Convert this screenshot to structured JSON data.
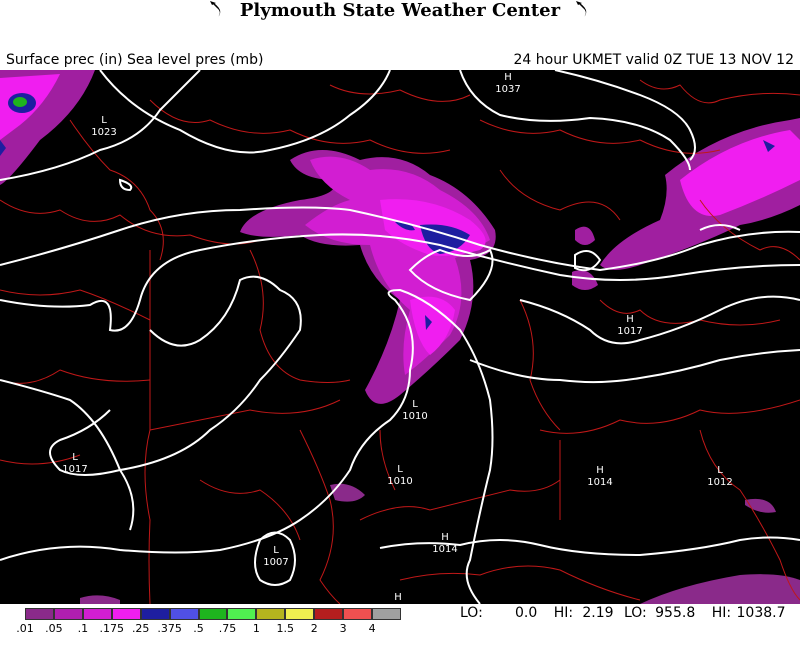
{
  "title": "Plymouth State Weather Center",
  "header": {
    "left": "Surface prec (in) Sea level pres (mb)",
    "right": "24 hour UKMET valid 0Z TUE 13 NOV 12"
  },
  "pressure_centers": [
    {
      "letter": "H",
      "value": "1037"
    },
    {
      "letter": "L",
      "value": "1023"
    },
    {
      "letter": "L",
      "value": "1017"
    },
    {
      "letter": "L",
      "value": "1010"
    },
    {
      "letter": "H",
      "value": "1017"
    },
    {
      "letter": "L",
      "value": "1010"
    },
    {
      "letter": "H",
      "value": "1014"
    },
    {
      "letter": "L",
      "value": "1012"
    },
    {
      "letter": "H",
      "value": "1014"
    },
    {
      "letter": "L",
      "value": "1007"
    },
    {
      "letter": "H",
      "value": ""
    }
  ],
  "legend": {
    "colors": [
      "#8a2a8a",
      "#b01fb0",
      "#d21ed2",
      "#f01ef0",
      "#1e1ea0",
      "#5050e6",
      "#1eb41e",
      "#50f050",
      "#b4b41e",
      "#f0f050",
      "#b41e1e",
      "#f05050",
      "#a0a0a0"
    ],
    "ticks": [
      ".01",
      ".05",
      ".1",
      ".175",
      ".25",
      ".375",
      ".5",
      ".75",
      "1",
      "1.5",
      "2",
      "3",
      "4"
    ]
  },
  "stats": {
    "lo_label": "LO:",
    "lo_value": "0.0",
    "hi_label": "HI:",
    "hi_value": "2.19",
    "lo2_label": "LO:",
    "lo2_value": "955.8",
    "hi2_label": "HI:",
    "hi2_value": "1038.7"
  }
}
